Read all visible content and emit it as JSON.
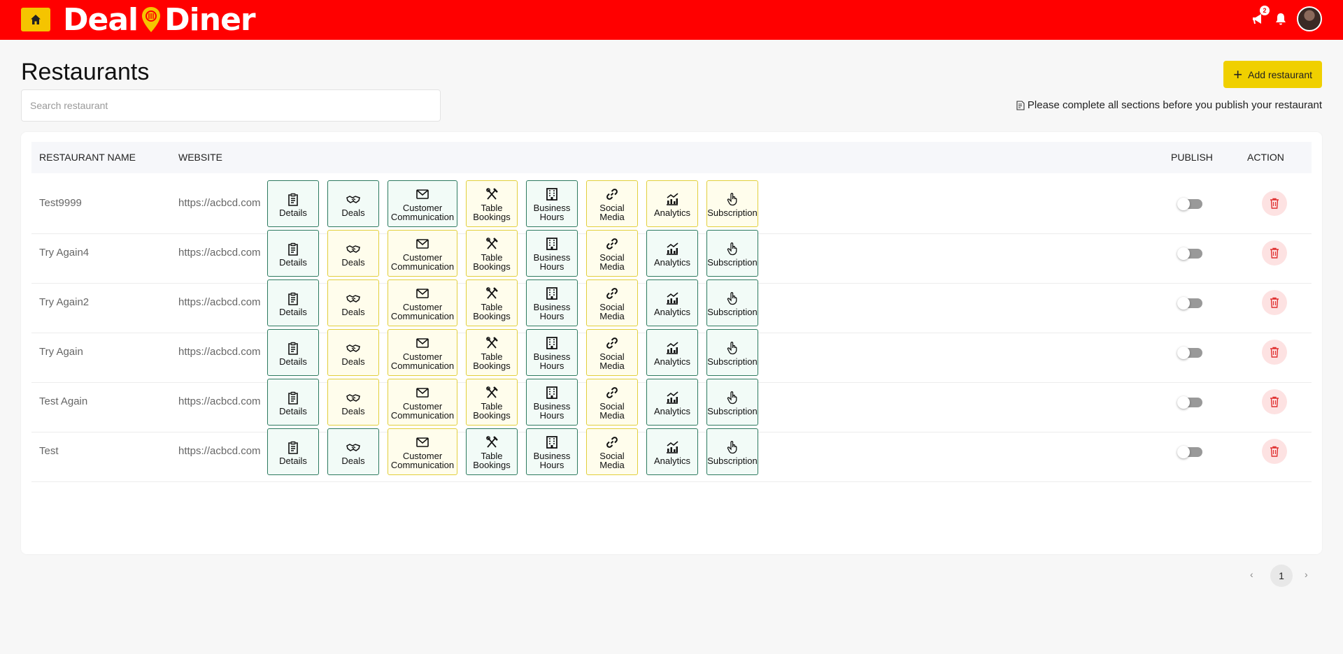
{
  "brand": {
    "word1": "Deal",
    "word2": "Diner"
  },
  "header": {
    "notification_count": "2"
  },
  "page": {
    "title": "Restaurants",
    "search_placeholder": "Search restaurant",
    "add_button": "Add restaurant",
    "notice": "Please complete all sections before you publish your restaurant"
  },
  "table": {
    "columns": {
      "name": "RESTAURANT NAME",
      "website": "WEBSITE",
      "publish": "PUBLISH",
      "action": "ACTION"
    },
    "sections": [
      {
        "key": "details",
        "label": "Details",
        "icon": "clipboard-icon"
      },
      {
        "key": "deals",
        "label": "Deals",
        "icon": "handshake-icon"
      },
      {
        "key": "communication",
        "label": "Customer\nCommunication",
        "icon": "envelope-icon"
      },
      {
        "key": "bookings",
        "label": "Table\nBookings",
        "icon": "utensils-icon"
      },
      {
        "key": "hours",
        "label": "Business\nHours",
        "icon": "building-icon"
      },
      {
        "key": "social",
        "label": "Social\nMedia",
        "icon": "link-icon"
      },
      {
        "key": "analytics",
        "label": "Analytics",
        "icon": "chart-icon"
      },
      {
        "key": "subscription",
        "label": "Subscription",
        "icon": "pointer-hand-icon"
      }
    ],
    "rows": [
      {
        "name": "Test9999",
        "website": "https://acbcd.com",
        "status": [
          "complete",
          "complete",
          "complete",
          "incomplete",
          "complete",
          "incomplete",
          "incomplete",
          "incomplete"
        ],
        "published": false
      },
      {
        "name": "Try Again4",
        "website": "https://acbcd.com",
        "status": [
          "complete",
          "incomplete",
          "incomplete",
          "incomplete",
          "complete",
          "incomplete",
          "complete",
          "complete"
        ],
        "published": false
      },
      {
        "name": "Try Again2",
        "website": "https://acbcd.com",
        "status": [
          "complete",
          "incomplete",
          "incomplete",
          "incomplete",
          "complete",
          "incomplete",
          "complete",
          "complete"
        ],
        "published": false
      },
      {
        "name": "Try Again",
        "website": "https://acbcd.com",
        "status": [
          "complete",
          "incomplete",
          "incomplete",
          "incomplete",
          "complete",
          "incomplete",
          "complete",
          "complete"
        ],
        "published": false
      },
      {
        "name": "Test Again",
        "website": "https://acbcd.com",
        "status": [
          "complete",
          "incomplete",
          "incomplete",
          "incomplete",
          "complete",
          "incomplete",
          "complete",
          "complete"
        ],
        "published": false
      },
      {
        "name": "Test",
        "website": "https://acbcd.com",
        "status": [
          "complete",
          "complete",
          "incomplete",
          "complete",
          "complete",
          "incomplete",
          "complete",
          "complete"
        ],
        "published": false
      }
    ]
  },
  "pagination": {
    "current": "1",
    "prev": "‹",
    "next": "›"
  },
  "colors": {
    "topbar": "#ff0000",
    "accent_yellow": "#f0d000",
    "complete_border": "#2d7a5f",
    "incomplete_border": "#e2cf3c"
  }
}
